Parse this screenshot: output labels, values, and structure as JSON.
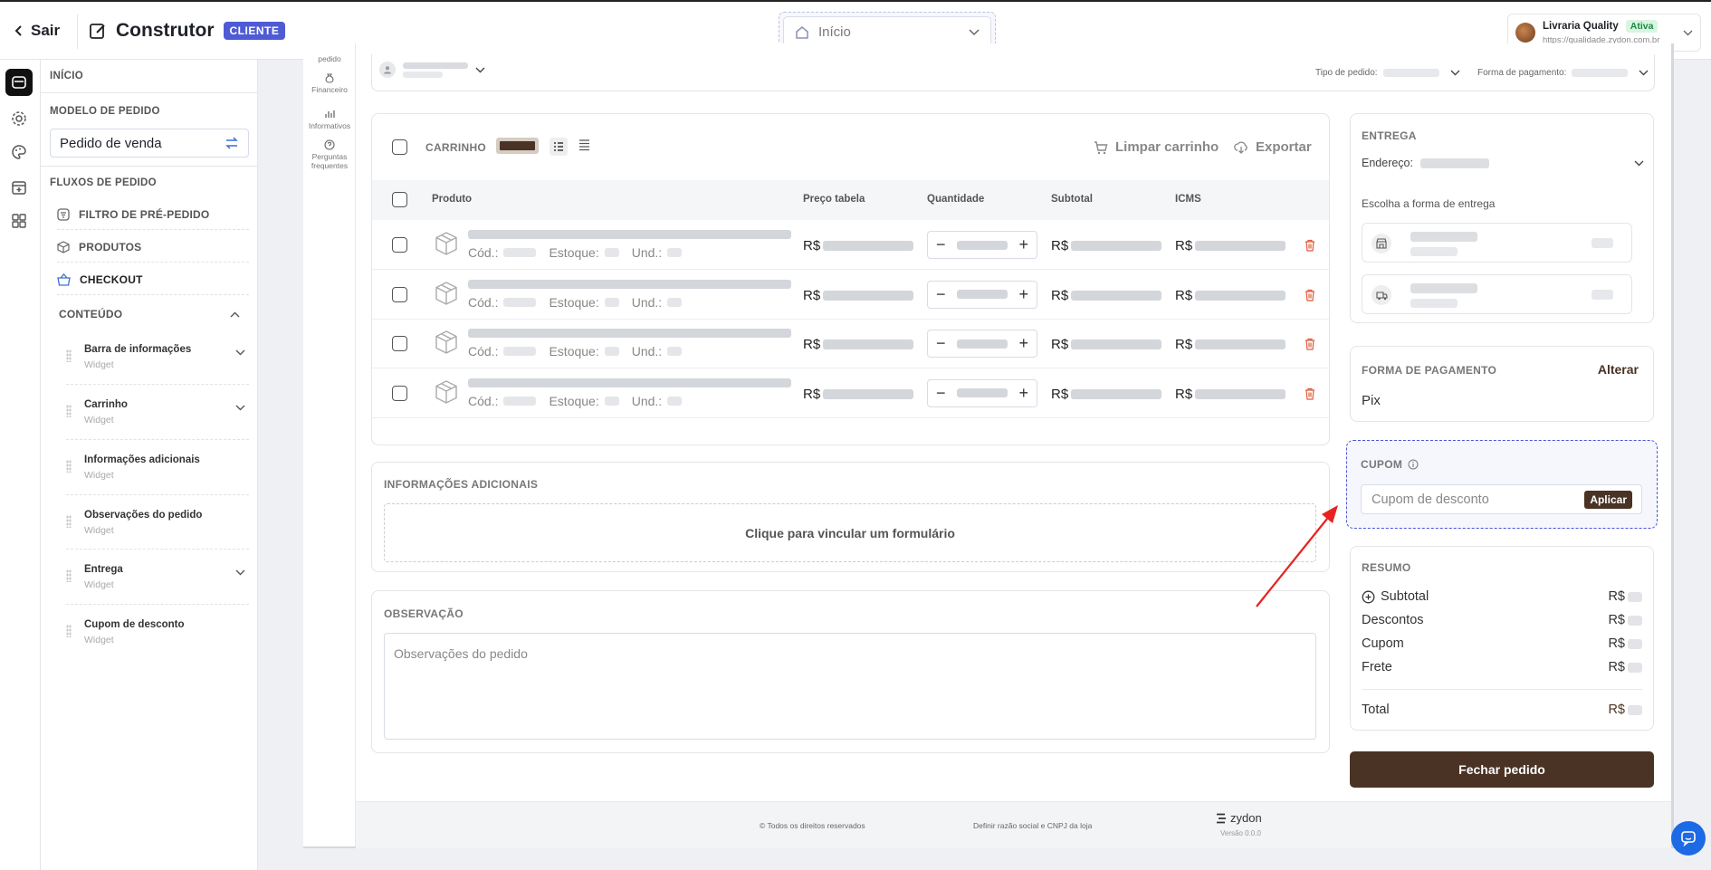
{
  "topbar": {
    "back_label": "Sair",
    "title": "Construtor",
    "badge": "CLIENTE",
    "page_select": "Início",
    "store": {
      "name": "Livraria Quality",
      "status": "Ativa",
      "url": "https://qualidade.zydon.com.br"
    }
  },
  "sidebar": {
    "home_label": "INÍCIO",
    "model_heading": "MODELO DE PEDIDO",
    "model_value": "Pedido de venda",
    "flows_heading": "FLUXOS DE PEDIDO",
    "flows": [
      {
        "label": "FILTRO DE PRÉ-PEDIDO",
        "icon": "filter-icon"
      },
      {
        "label": "PRODUTOS",
        "icon": "box-icon"
      },
      {
        "label": "CHECKOUT",
        "icon": "basket-icon"
      }
    ],
    "content_heading": "CONTEÚDO",
    "widgets": [
      {
        "name": "Barra de informações",
        "type": "Widget",
        "expandable": true
      },
      {
        "name": "Carrinho",
        "type": "Widget",
        "expandable": true
      },
      {
        "name": "Informações adicionais",
        "type": "Widget",
        "expandable": false
      },
      {
        "name": "Observações do pedido",
        "type": "Widget",
        "expandable": false
      },
      {
        "name": "Entrega",
        "type": "Widget",
        "expandable": true
      },
      {
        "name": "Cupom de desconto",
        "type": "Widget",
        "expandable": false
      }
    ]
  },
  "canvas": {
    "mini_rail": [
      "pedido",
      "Financeiro",
      "Informativos",
      "Perguntas frequentes"
    ],
    "filterbar": {
      "order_type_label": "Tipo de pedido:",
      "payment_label": "Forma de pagamento:"
    },
    "cart": {
      "heading": "CARRINHO",
      "clear_label": "Limpar carrinho",
      "export_label": "Exportar",
      "columns": [
        "Produto",
        "Preço tabela",
        "Quantidade",
        "Subtotal",
        "ICMS"
      ],
      "meta_labels": {
        "code": "Cód.:",
        "stock": "Estoque:",
        "unit": "Und.:"
      },
      "currency": "R$",
      "row_count": 4
    },
    "info": {
      "heading": "INFORMAÇÕES ADICIONAIS",
      "dropzone_label": "Clique para vincular um formulário"
    },
    "observation": {
      "heading": "OBSERVAÇÃO",
      "placeholder": "Observações do pedido"
    },
    "delivery": {
      "heading": "ENTREGA",
      "address_label": "Endereço:",
      "choose_label": "Escolha a forma de entrega"
    },
    "payment": {
      "heading": "FORMA DE PAGAMENTO",
      "change_label": "Alterar",
      "value": "Pix"
    },
    "coupon": {
      "heading": "CUPOM",
      "placeholder": "Cupom de desconto",
      "apply_label": "Aplicar"
    },
    "summary": {
      "heading": "RESUMO",
      "rows": [
        "Subtotal",
        "Descontos",
        "Cupom",
        "Frete"
      ],
      "total_label": "Total",
      "currency": "R$"
    },
    "close_button": "Fechar pedido",
    "footer": {
      "rights": "© Todos os direitos reservados",
      "define": "Definir razão social e CNPJ da loja",
      "brand": "zydon",
      "version": "Versão 0.0.0"
    }
  },
  "colors": {
    "accent": "#4f5bd5",
    "brand_brown": "#4a3324",
    "danger": "#e05a3a",
    "status_green": "#1c8a44"
  }
}
